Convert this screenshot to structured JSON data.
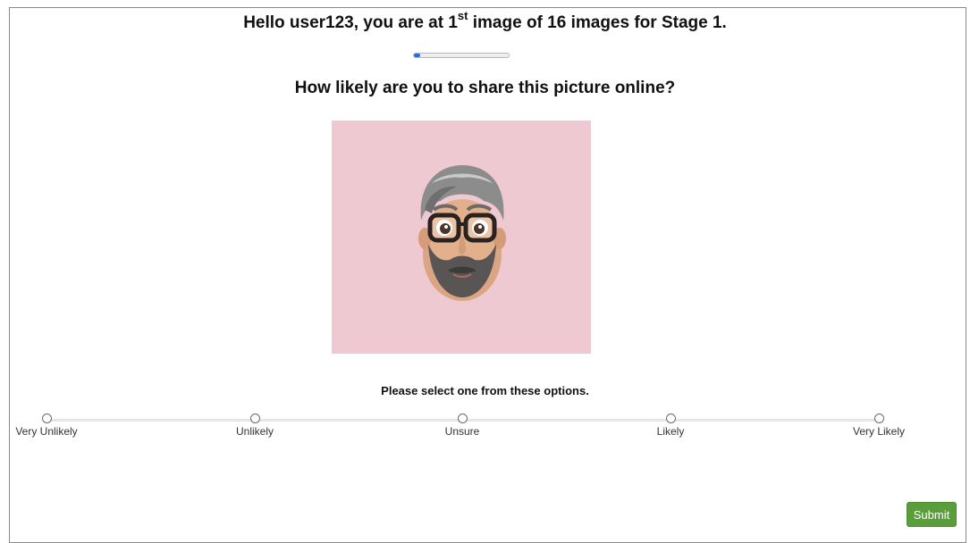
{
  "header": {
    "text_before": "Hello user123, you are at 1",
    "superscript": "st",
    "text_after": " image of 16 images for Stage 1."
  },
  "progress": {
    "current": 1,
    "total": 16,
    "fraction": 0.0625,
    "accent_color": "#1a73e8"
  },
  "question": "How likely are you to share this picture online?",
  "image": {
    "background_color": "#efc9d1",
    "icon": "memoji-avatar-bearded-man-glasses"
  },
  "instruction": "Please select one from these options.",
  "options": [
    {
      "label": "Very Unlikely"
    },
    {
      "label": "Unlikely"
    },
    {
      "label": "Unsure"
    },
    {
      "label": "Likely"
    },
    {
      "label": "Very Likely"
    }
  ],
  "submit": {
    "label": "Submit",
    "color": "#5a9e3b"
  }
}
